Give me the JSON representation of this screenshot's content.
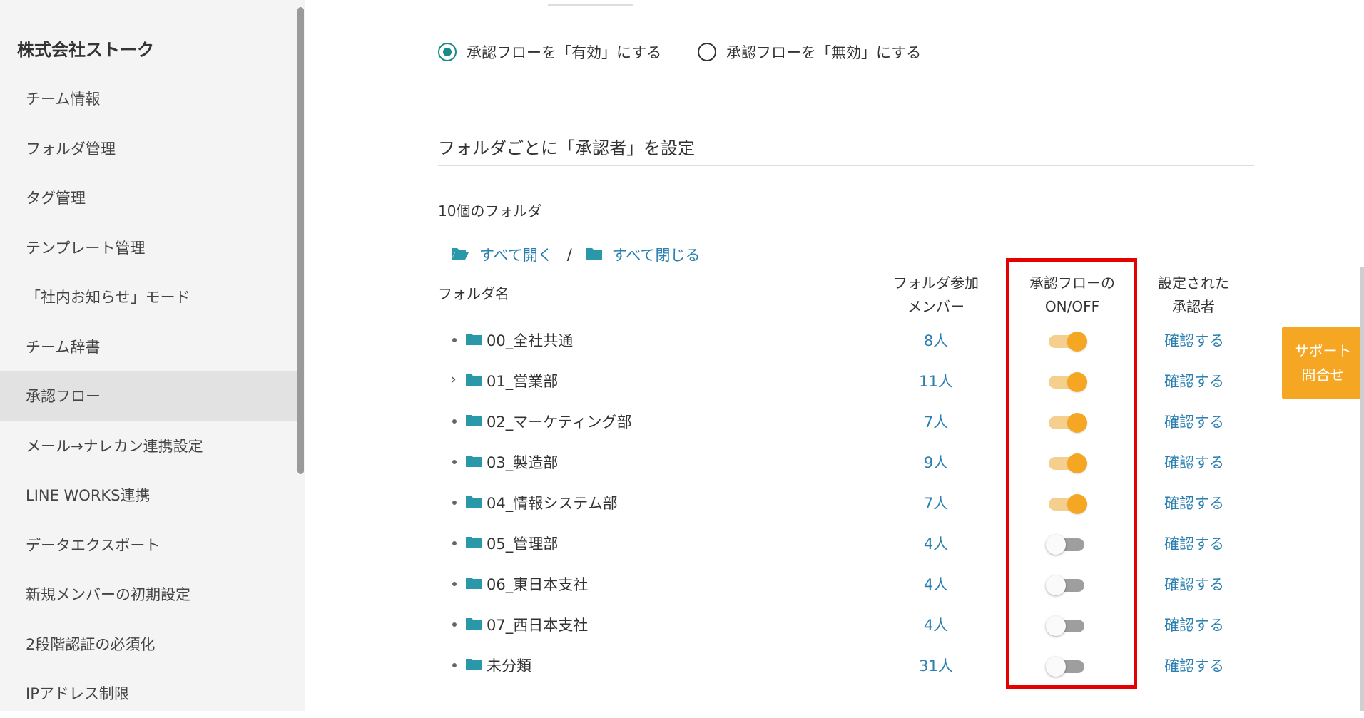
{
  "sidebar": {
    "company": "株式会社ストーク",
    "items": [
      {
        "label": "チーム情報",
        "active": false
      },
      {
        "label": "フォルダ管理",
        "active": false
      },
      {
        "label": "タグ管理",
        "active": false
      },
      {
        "label": "テンプレート管理",
        "active": false
      },
      {
        "label": "「社内お知らせ」モード",
        "active": false
      },
      {
        "label": "チーム辞書",
        "active": false
      },
      {
        "label": "承認フロー",
        "active": true
      },
      {
        "label": "メール→ナレカン連携設定",
        "active": false
      },
      {
        "label": "LINE WORKS連携",
        "active": false
      },
      {
        "label": "データエクスポート",
        "active": false
      },
      {
        "label": "新規メンバーの初期設定",
        "active": false
      },
      {
        "label": "2段階認証の必須化",
        "active": false
      },
      {
        "label": "IPアドレス制限",
        "active": false
      }
    ]
  },
  "approval": {
    "enable_label": "承認フローを「有効」にする",
    "disable_label": "承認フローを「無効」にする",
    "selected": "enable"
  },
  "section_title": "フォルダごとに「承認者」を設定",
  "folder_count": "10個のフォルダ",
  "open_all": "すべて開く",
  "separator": "/",
  "close_all": "すべて閉じる",
  "table": {
    "col_name": "フォルダ名",
    "col_members_1": "フォルダ参加",
    "col_members_2": "メンバー",
    "col_flow_1": "承認フローの",
    "col_flow_2": "ON/OFF",
    "col_approver_1": "設定された",
    "col_approver_2": "承認者",
    "rows": [
      {
        "name": "00_全社共通",
        "members": "8人",
        "on": true,
        "expand": false,
        "confirm": "確認する"
      },
      {
        "name": "01_営業部",
        "members": "11人",
        "on": true,
        "expand": true,
        "confirm": "確認する"
      },
      {
        "name": "02_マーケティング部",
        "members": "7人",
        "on": true,
        "expand": false,
        "confirm": "確認する"
      },
      {
        "name": "03_製造部",
        "members": "9人",
        "on": true,
        "expand": false,
        "confirm": "確認する"
      },
      {
        "name": "04_情報システム部",
        "members": "7人",
        "on": true,
        "expand": false,
        "confirm": "確認する"
      },
      {
        "name": "05_管理部",
        "members": "4人",
        "on": false,
        "expand": false,
        "confirm": "確認する"
      },
      {
        "name": "06_東日本支社",
        "members": "4人",
        "on": false,
        "expand": false,
        "confirm": "確認する"
      },
      {
        "name": "07_西日本支社",
        "members": "4人",
        "on": false,
        "expand": false,
        "confirm": "確認する"
      },
      {
        "name": "未分類",
        "members": "31人",
        "on": false,
        "expand": false,
        "confirm": "確認する"
      }
    ]
  },
  "support": {
    "line1": "サポート",
    "line2": "問合せ"
  },
  "colors": {
    "accent": "#1a8a8a",
    "link": "#2a7fb0",
    "toggle_on": "#f5a623",
    "highlight": "#e60000"
  }
}
